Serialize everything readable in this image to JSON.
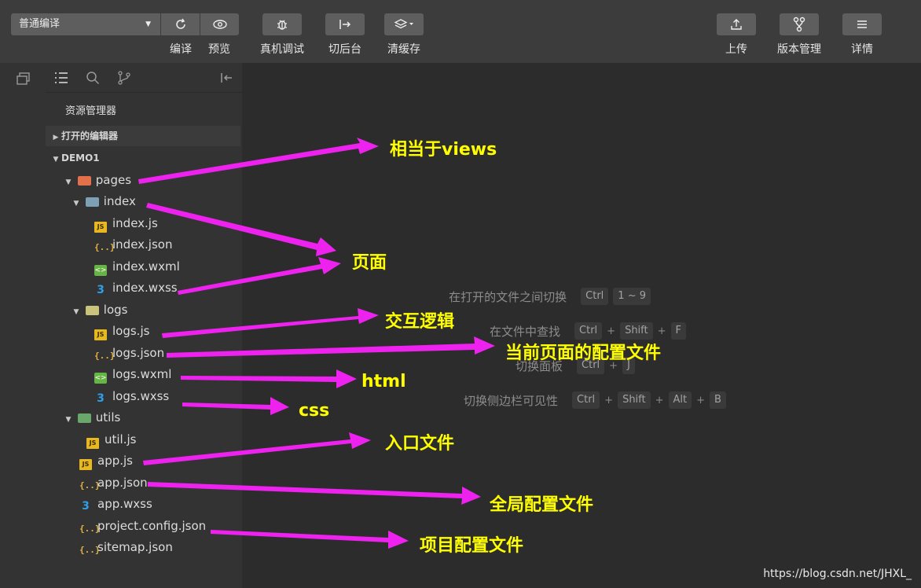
{
  "toolbar": {
    "compile_mode": "普通编译",
    "compile_label": "编译",
    "preview_label": "预览",
    "remote_debug_label": "真机调试",
    "background_label": "切后台",
    "clear_cache_label": "清缓存",
    "upload_label": "上传",
    "version_label": "版本管理",
    "details_label": "详情"
  },
  "sidebar": {
    "title": "资源管理器",
    "open_editors": "打开的编辑器",
    "project": "DEMO1",
    "tree": {
      "pages": "pages",
      "index": "index",
      "index_js": "index.js",
      "index_json": "index.json",
      "index_wxml": "index.wxml",
      "index_wxss": "index.wxss",
      "logs": "logs",
      "logs_js": "logs.js",
      "logs_json": "logs.json",
      "logs_wxml": "logs.wxml",
      "logs_wxss": "logs.wxss",
      "utils": "utils",
      "util_js": "util.js",
      "app_js": "app.js",
      "app_json": "app.json",
      "app_wxss": "app.wxss",
      "project_config": "project.config.json",
      "sitemap": "sitemap.json"
    }
  },
  "shortcuts": {
    "switch_files": {
      "desc": "在打开的文件之间切换",
      "k1": "Ctrl",
      "k2": "1 ~ 9"
    },
    "find_in_files": {
      "desc": "在文件中查找",
      "k1": "Ctrl",
      "k2": "Shift",
      "k3": "F"
    },
    "toggle_panel": {
      "desc": "切换面板",
      "k1": "Ctrl",
      "k2": "J"
    },
    "toggle_sidebar": {
      "desc": "切换侧边栏可见性",
      "k1": "Ctrl",
      "k2": "Shift",
      "k3": "Alt",
      "k4": "B"
    }
  },
  "annotations": {
    "views": "相当于views",
    "page": "页面",
    "logic": "交互逻辑",
    "page_config": "当前页面的配置文件",
    "html": "html",
    "css": "css",
    "entry": "入口文件",
    "global_config": "全局配置文件",
    "project_config": "项目配置文件"
  },
  "watermark": "https://blog.csdn.net/JHXL_",
  "colors": {
    "annotation_text": "#ffff00",
    "arrow": "#ee22ee",
    "toolbar_bg": "#3c3c3c",
    "sidebar_bg": "#333333",
    "editor_bg": "#2c2c2c"
  }
}
